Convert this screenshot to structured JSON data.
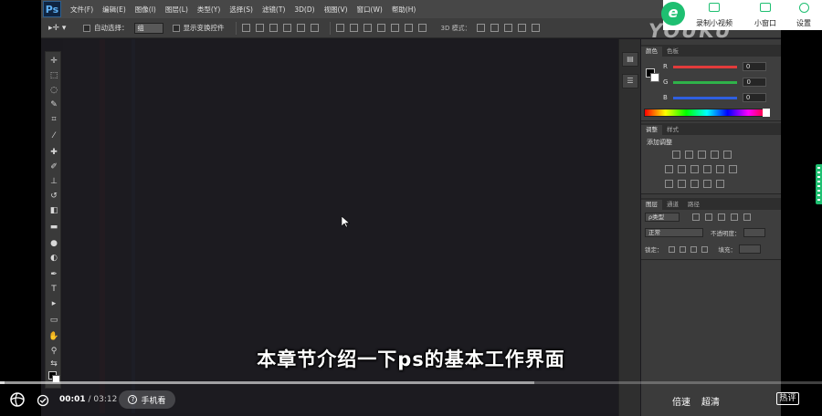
{
  "photoshop": {
    "logo": "Ps",
    "menu": [
      "文件(F)",
      "编辑(E)",
      "图像(I)",
      "图层(L)",
      "类型(Y)",
      "选择(S)",
      "滤镜(T)",
      "3D(D)",
      "视图(V)",
      "窗口(W)",
      "帮助(H)"
    ],
    "options": {
      "auto_select_label": "自动选择：",
      "auto_select_value": "组",
      "show_transform_label": "显示变换控件",
      "mode_3d_label": "3D 模式："
    },
    "color_panel": {
      "tabs": [
        "颜色",
        "色板"
      ],
      "rows": [
        {
          "label": "R",
          "value": "0",
          "color": "#e23b3b"
        },
        {
          "label": "G",
          "value": "0",
          "color": "#2fb24a"
        },
        {
          "label": "B",
          "value": "0",
          "color": "#2f5fe0"
        }
      ]
    },
    "adjust_panel": {
      "tabs": [
        "调整",
        "样式"
      ],
      "title": "添加调整"
    },
    "layers_panel": {
      "tabs": [
        "图层",
        "通道",
        "路径"
      ],
      "kind_label": "ρ类型",
      "blend_mode": "正常",
      "opacity_label": "不透明度：",
      "lock_label": "锁定：",
      "fill_label": "填充："
    }
  },
  "subtitle": "本章节介绍一下ps的基本工作界面",
  "player": {
    "current_time": "00:01",
    "separator": " / ",
    "total_time": "03:12",
    "progress": 0.005,
    "buffered": 0.65,
    "phone_watch_label": "手机看",
    "speed_label": "倍速",
    "quality_label": "超清",
    "danmaku_label": "热评"
  },
  "overlay": {
    "watermark": "YOUKU",
    "record_label": "录制小视频",
    "mini_label": "小窗口",
    "settings_label": "设置",
    "accent": "#1ebf71"
  }
}
